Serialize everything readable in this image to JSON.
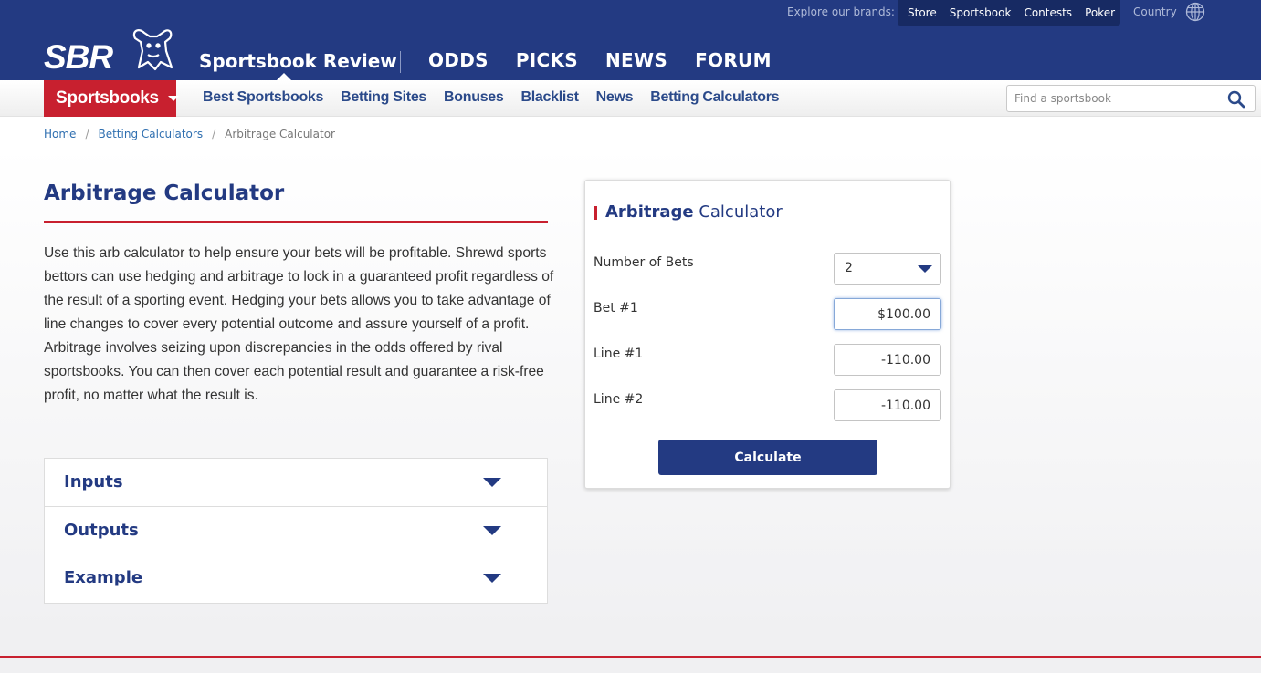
{
  "header": {
    "brands_label": "Explore our brands:",
    "brands": [
      "Store",
      "Sportsbook",
      "Contests",
      "Poker"
    ],
    "country_label": "Country",
    "logo_text": "SBR",
    "site_title": "Sportsbook Review",
    "main_nav": [
      "ODDS",
      "PICKS",
      "NEWS",
      "FORUM"
    ],
    "brand_color": "#233a82",
    "accent_color": "#c8202f"
  },
  "subnav": {
    "sportsbooks_label": "Sportsbooks",
    "links": [
      "Best Sportsbooks",
      "Betting Sites",
      "Bonuses",
      "Blacklist",
      "News",
      "Betting Calculators"
    ],
    "search_placeholder": "Find a sportsbook"
  },
  "breadcrumb": {
    "home": "Home",
    "section": "Betting Calculators",
    "current": "Arbitrage Calculator",
    "separator": "/"
  },
  "main": {
    "title": "Arbitrage Calculator",
    "intro": "Use this arb calculator to help ensure your bets will be profitable. Shrewd sports bettors can use hedging and arbitrage to lock in a guaranteed profit regardless of the result of a sporting event. Hedging your bets allows you to take advantage of line changes to cover every potential outcome and assure yourself of a profit. Arbitrage involves seizing upon discrepancies in the odds offered by rival sportsbooks. You can then cover each potential result and guarantee a risk-free profit, no matter what the result is.",
    "accordion": [
      "Inputs",
      "Outputs",
      "Example"
    ]
  },
  "calculator": {
    "title_bold": "Arbitrage",
    "title_light": "Calculator",
    "number_of_bets_label": "Number of Bets",
    "number_of_bets_value": "2",
    "bet1_label": "Bet #1",
    "bet1_value": "$100.00",
    "line1_label": "Line #1",
    "line1_value": "-110.00",
    "line2_label": "Line #2",
    "line2_value": "-110.00",
    "button_label": "Calculate"
  }
}
